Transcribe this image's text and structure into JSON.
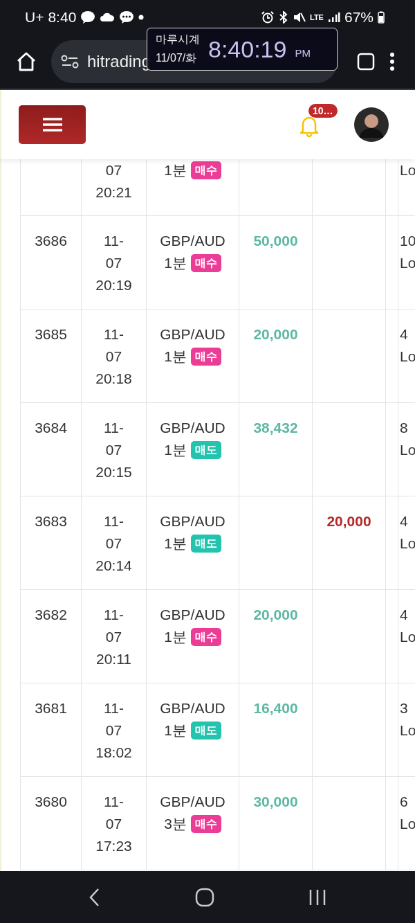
{
  "status_bar": {
    "carrier": "U+",
    "time": "8:40",
    "network": "LTE",
    "battery": "67%"
  },
  "browser": {
    "url": "hitrading"
  },
  "clock_widget": {
    "title": "마루시계",
    "date": "11/07/화",
    "time": "8:40:19",
    "ampm": "PM"
  },
  "header": {
    "notification_count": "10…"
  },
  "rows": [
    {
      "partial": true,
      "date": [
        "07",
        "20:21"
      ],
      "period": "1분",
      "tag": {
        "kind": "buy",
        "label": "매수"
      },
      "lots": [
        "Lo"
      ]
    },
    {
      "id": "3686",
      "date": [
        "11-",
        "07",
        "20:19"
      ],
      "pair": "GBP/AUD",
      "period": "1분",
      "tag": {
        "kind": "buy",
        "label": "매수"
      },
      "profit": "50,000",
      "lots": [
        "10",
        "Lo"
      ]
    },
    {
      "id": "3685",
      "date": [
        "11-",
        "07",
        "20:18"
      ],
      "pair": "GBP/AUD",
      "period": "1분",
      "tag": {
        "kind": "buy",
        "label": "매수"
      },
      "profit": "20,000",
      "lots": [
        "4",
        "Lo"
      ]
    },
    {
      "id": "3684",
      "date": [
        "11-",
        "07",
        "20:15"
      ],
      "pair": "GBP/AUD",
      "period": "1분",
      "tag": {
        "kind": "sell",
        "label": "매도"
      },
      "profit": "38,432",
      "lots": [
        "8",
        "Lo"
      ]
    },
    {
      "id": "3683",
      "date": [
        "11-",
        "07",
        "20:14"
      ],
      "pair": "GBP/AUD",
      "period": "1분",
      "tag": {
        "kind": "sell",
        "label": "매도"
      },
      "loss": "20,000",
      "lots": [
        "4",
        "Lo"
      ]
    },
    {
      "id": "3682",
      "date": [
        "11-",
        "07",
        "20:11"
      ],
      "pair": "GBP/AUD",
      "period": "1분",
      "tag": {
        "kind": "buy",
        "label": "매수"
      },
      "profit": "20,000",
      "lots": [
        "4",
        "Lo"
      ]
    },
    {
      "id": "3681",
      "date": [
        "11-",
        "07",
        "18:02"
      ],
      "pair": "GBP/AUD",
      "period": "1분",
      "tag": {
        "kind": "sell",
        "label": "매도"
      },
      "profit": "16,400",
      "lots": [
        "3",
        "Lo"
      ]
    },
    {
      "id": "3680",
      "date": [
        "11-",
        "07",
        "17:23"
      ],
      "pair": "GBP/AUD",
      "period": "3분",
      "tag": {
        "kind": "buy",
        "label": "매수"
      },
      "profit": "30,000",
      "lots": [
        "6",
        "Lo"
      ]
    }
  ]
}
